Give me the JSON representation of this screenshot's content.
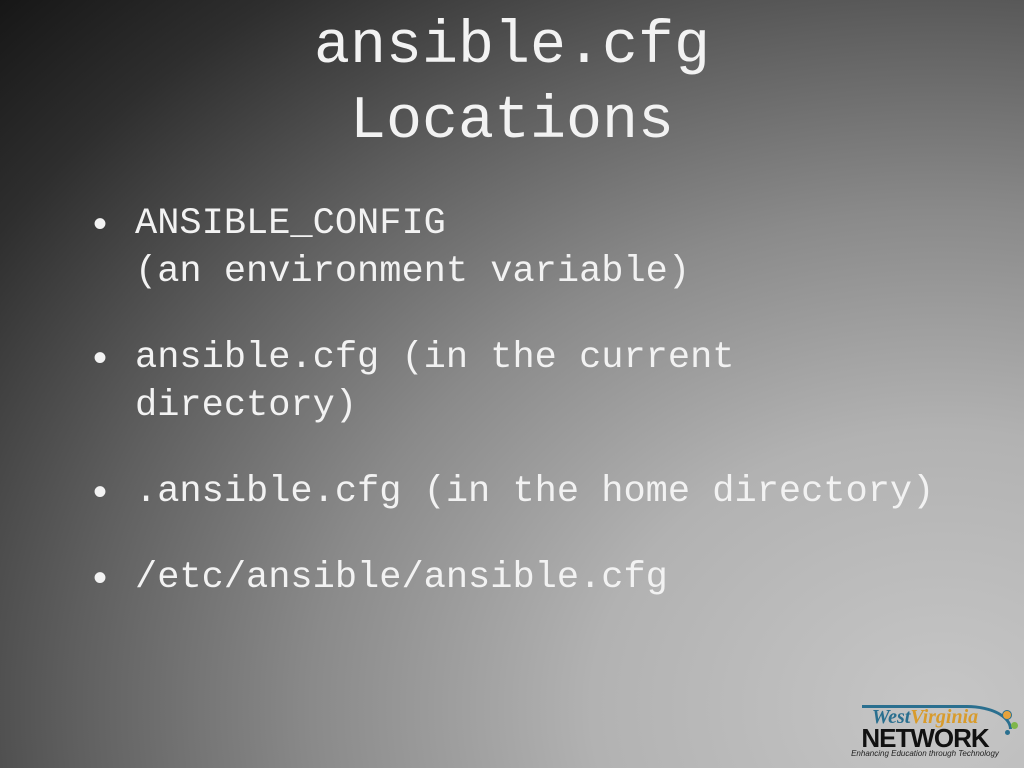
{
  "title": "ansible.cfg\nLocations",
  "bullets": [
    "ANSIBLE_CONFIG\n(an environment variable)",
    "ansible.cfg (in the current directory)",
    ".ansible.cfg (in the home directory)",
    "/etc/ansible/ansible.cfg"
  ],
  "logo": {
    "line1_a": "West",
    "line1_b": "Virginia",
    "line2": "NETWORK",
    "tagline": "Enhancing Education through Technology"
  }
}
